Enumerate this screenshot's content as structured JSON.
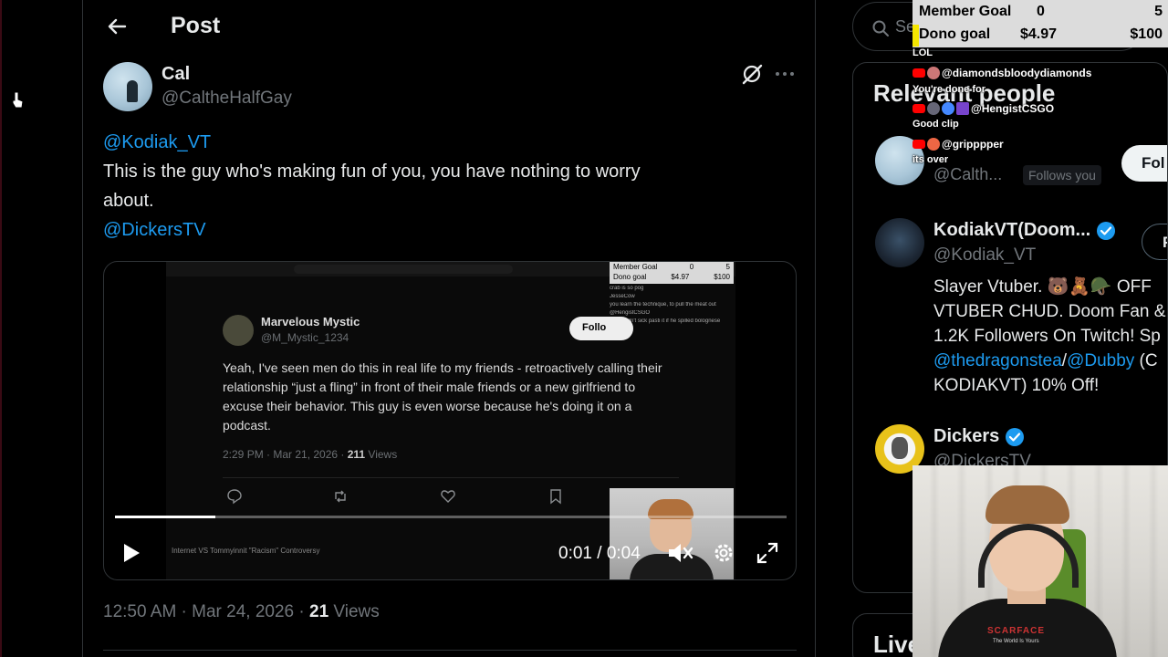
{
  "page": {
    "title": "Post"
  },
  "post": {
    "author_name": "Cal",
    "author_handle": "@CaltheHalfGay",
    "mention_1": "@Kodiak_VT",
    "text_line_1": " This is the guy who's making fun of you, you have nothing to worry",
    "text_line_2": "about.",
    "mention_2": "@DickersTV",
    "timestamp": "12:50 AM · Mar 24, 2026 · ",
    "views_count": "21",
    "views_label": " Views"
  },
  "video": {
    "time": "0:01 / 0:04",
    "progress": 0.15,
    "embedded": {
      "goal_member_label": "Member Goal",
      "goal_member_cur": "0",
      "goal_member_tgt": "5",
      "goal_dono_label": "Dono goal",
      "goal_dono_cur": "$4.97",
      "goal_dono_tgt": "$100",
      "name": "Marvelous Mystic",
      "handle": "@M_Mystic_1234",
      "follow_label": "Follo",
      "body": "Yeah, I've seen men do this in real life to my friends - retroactively calling their relationship “just a fling” in front of their male friends or a new girlfriend to excuse their behavior. This guy is even worse because he's doing it on a podcast.",
      "meta_time": "2:29 PM · Mar 21, 2026 · ",
      "meta_views": "211",
      "meta_views_label": " Views",
      "chat_lines": [
        "crab is so pog",
        "JesseCow",
        "you learn the technique, to pull the meat out",
        "@HengistCSGO",
        "and I didn't sick pasti it if he spilled bolognese"
      ],
      "bottom_text": "Internet VS Tommyinnit \"Racism\" Controversy"
    }
  },
  "sidebar": {
    "search_placeholder": "Se",
    "relevant_title": "Relevant people",
    "person_1": {
      "handle": "@Calth...",
      "follows_you": "Follows you",
      "follow_label": "Fol"
    },
    "person_2": {
      "name": "KodiakVT(Doom...",
      "handle": "@Kodiak_VT",
      "follow_label": "F",
      "bio_line_1": "Slayer Vtuber. 🐻🧸🪖 OFF",
      "bio_line_2": "VTUBER CHUD. Doom Fan &",
      "bio_line_3": "1.2K Followers On Twitch! Sp",
      "bio_link_1": "@thedragonstea",
      "bio_sep": "/",
      "bio_link_2": "@Dubby",
      "bio_after": " (C",
      "bio_line_5": "KODIAKVT) 10% Off!"
    },
    "person_3": {
      "name": "Dickers",
      "handle": "@DickersTV"
    },
    "live_title": "Live"
  },
  "overlay": {
    "goal_member_label": "Member Goal",
    "goal_member_current": "0",
    "goal_member_target": "5",
    "goal_dono_label": "Dono goal",
    "goal_dono_current": "$4.97",
    "goal_dono_target": "$100",
    "chat": [
      {
        "type": "msg",
        "text": "LOL"
      },
      {
        "type": "user",
        "name": "@diamondsbloodydiamonds"
      },
      {
        "type": "msg",
        "text": "You're done for"
      },
      {
        "type": "user",
        "name": "@HengistCSGO"
      },
      {
        "type": "msg",
        "text": "Good clip"
      },
      {
        "type": "user",
        "name": "@gripppper"
      },
      {
        "type": "msg",
        "text": "its over"
      }
    ],
    "shirt_print": "SCARFACE",
    "shirt_print_small": "The World Is Yours"
  },
  "colors": {
    "accent": "#1d9bf0",
    "background": "#000000",
    "muted_text": "#71767b",
    "goal_bar": "#f5e600",
    "youtube": "#ff0000"
  },
  "icons": {
    "back": "arrow-left-icon",
    "grok": "grok-slash-icon",
    "more": "more-horizontal-icon",
    "play": "play-icon",
    "volume": "volume-muted-icon",
    "settings": "gear-icon",
    "fullscreen": "fullscreen-icon",
    "search": "search-icon",
    "verified": "verified-badge-icon"
  }
}
